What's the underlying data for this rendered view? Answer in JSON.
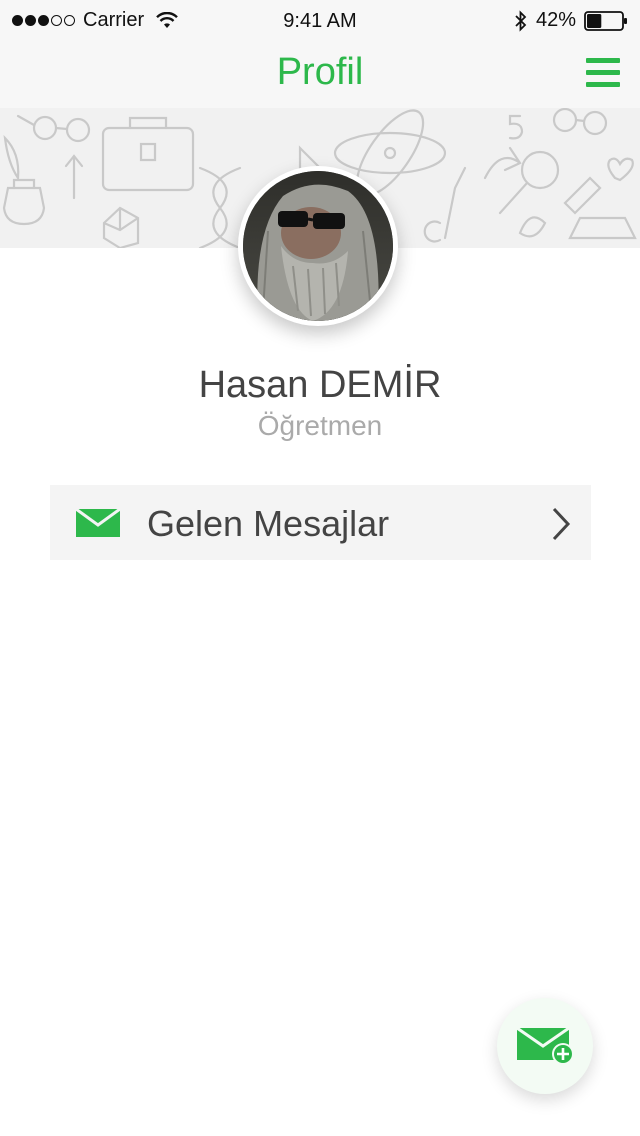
{
  "status_bar": {
    "carrier": "Carrier",
    "time": "9:41 AM",
    "battery": "42%",
    "signal_bars_filled": 3,
    "signal_bars_total": 5,
    "battery_level": 0.42
  },
  "nav": {
    "title": "Profil",
    "menu_icon": "hamburger-menu-icon",
    "title_color": "#2db84b"
  },
  "profile": {
    "name": "Hasan DEMİR",
    "role": "Öğretmen",
    "avatar_icon": "profile-photo"
  },
  "menu": {
    "items": [
      {
        "label": "Gelen Mesajlar",
        "icon": "mail-icon",
        "trailing_icon": "chevron-right-icon"
      }
    ]
  },
  "fab": {
    "icon": "new-message-icon"
  },
  "colors": {
    "accent": "#2db84b",
    "header_bg": "#f7f7f7",
    "row_bg": "#f4f4f4",
    "text": "#444444",
    "subtext": "#aaaaaa"
  }
}
